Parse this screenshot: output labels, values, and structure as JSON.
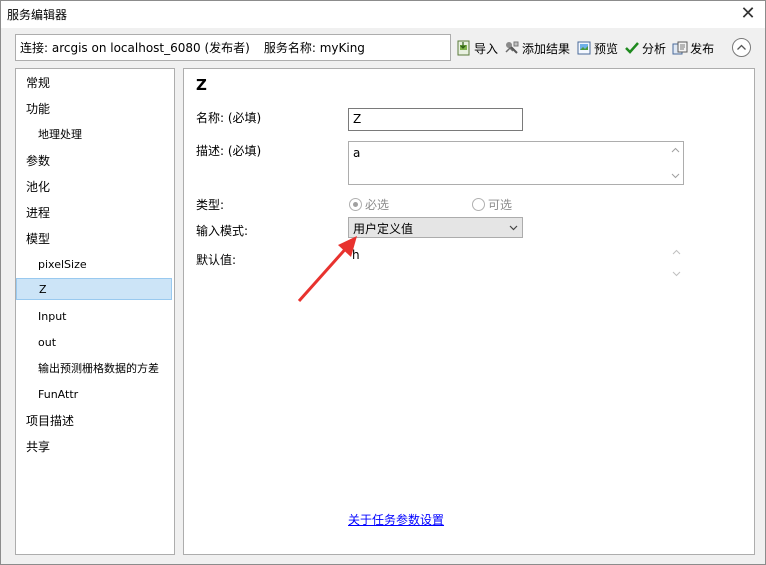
{
  "window": {
    "title": "服务编辑器",
    "close_glyph": "✕"
  },
  "connection": {
    "label": "连接: arcgis on localhost_6080 (发布者)",
    "service_name": "服务名称: myKing"
  },
  "toolbar": {
    "import_label": "导入",
    "add_result_label": "添加结果",
    "preview_label": "预览",
    "analyze_label": "分析",
    "publish_label": "发布"
  },
  "sidebar": {
    "items": [
      {
        "label": "常规"
      },
      {
        "label": "功能"
      },
      {
        "label": "地理处理"
      },
      {
        "label": "参数"
      },
      {
        "label": "池化"
      },
      {
        "label": "进程"
      },
      {
        "label": "模型"
      },
      {
        "label": "pixelSize"
      },
      {
        "label": "Z"
      },
      {
        "label": "Input"
      },
      {
        "label": "out"
      },
      {
        "label": "输出预测栅格数据的方差"
      },
      {
        "label": "FunAttr"
      },
      {
        "label": "项目描述"
      },
      {
        "label": "共享"
      }
    ],
    "selected": "Z"
  },
  "panel": {
    "heading": "Z",
    "name_label": "名称: (必填)",
    "name_value": "Z",
    "desc_label": "描述: (必填)",
    "desc_value": "a",
    "type_label": "类型:",
    "required_option": "必选",
    "optional_option": "可选",
    "input_mode_label": "输入模式:",
    "input_mode_value": "用户定义值",
    "default_label": "默认值:",
    "default_value": "h",
    "task_params_link": "关于任务参数设置"
  },
  "colors": {
    "selection": "#cce4f7",
    "link": "#0000ff",
    "annotation_arrow": "#e8322e"
  },
  "icons": {
    "import": "import-icon",
    "add_result": "add-result-icon",
    "preview": "preview-icon",
    "analyze": "checkmark-icon",
    "publish": "publish-icon",
    "collapse": "chevron-up-icon",
    "close": "close-icon"
  }
}
